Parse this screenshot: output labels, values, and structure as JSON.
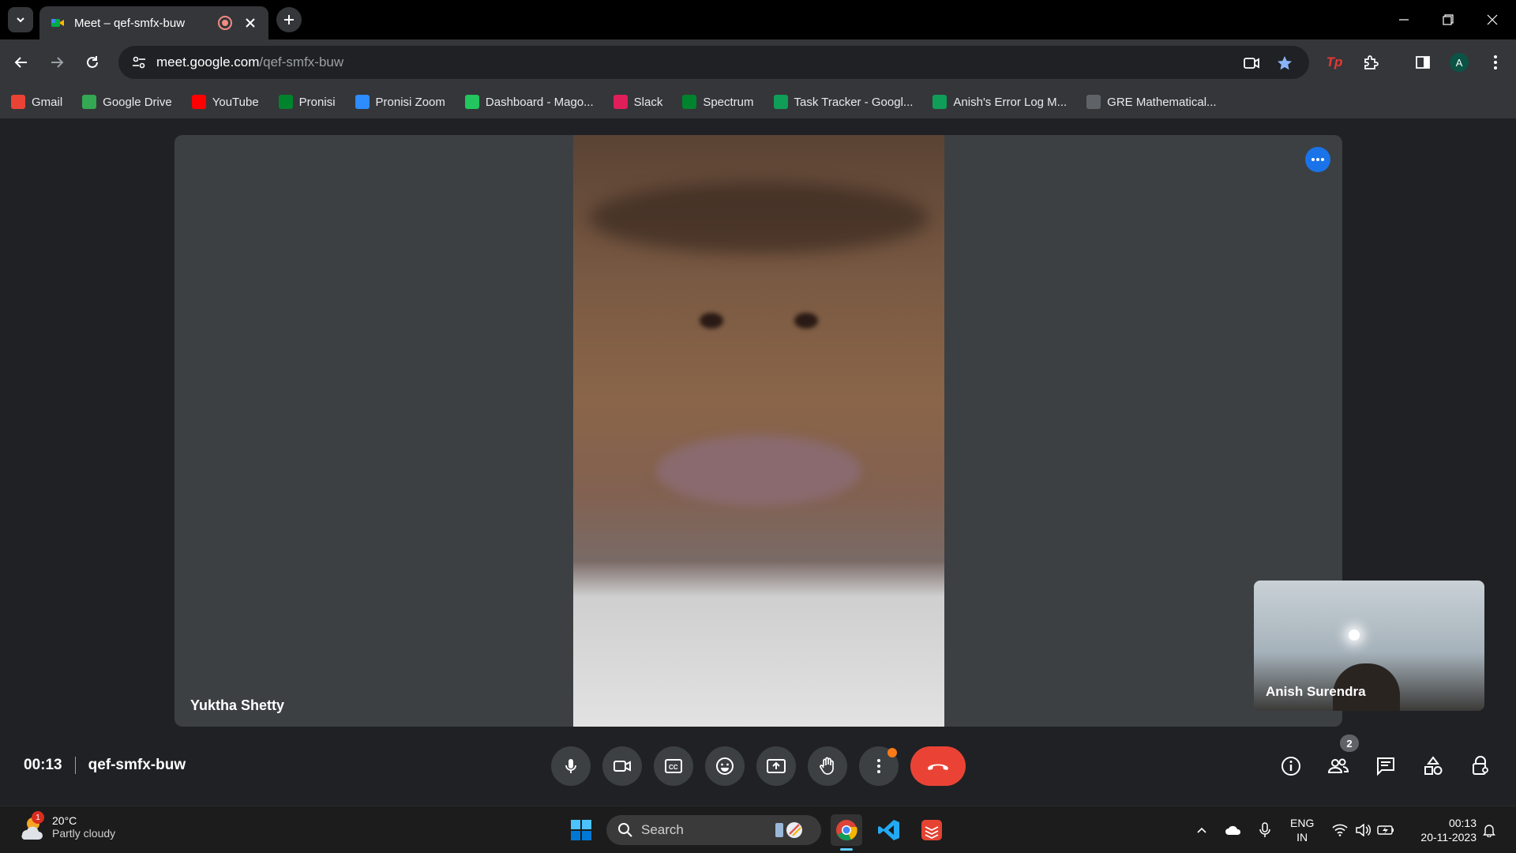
{
  "browser": {
    "tab_title": "Meet – qef-smfx-buw",
    "url_host": "meet.google.com",
    "url_path": "/qef-smfx-buw",
    "profile_initial": "A"
  },
  "bookmarks": [
    {
      "label": "Gmail",
      "icon": "gmail-icon",
      "color": "#ea4335"
    },
    {
      "label": "Google Drive",
      "icon": "drive-icon",
      "color": "#34a853"
    },
    {
      "label": "YouTube",
      "icon": "youtube-icon",
      "color": "#ff0000"
    },
    {
      "label": "Pronisi",
      "icon": "meet-icon",
      "color": "#00832d"
    },
    {
      "label": "Pronisi Zoom",
      "icon": "zoom-icon",
      "color": "#2d8cff"
    },
    {
      "label": "Dashboard - Mago...",
      "icon": "dashboard-icon",
      "color": "#22c55e"
    },
    {
      "label": "Slack",
      "icon": "slack-icon",
      "color": "#e01e5a"
    },
    {
      "label": "Spectrum",
      "icon": "meet-icon",
      "color": "#00832d"
    },
    {
      "label": "Task Tracker - Googl...",
      "icon": "sheets-icon",
      "color": "#0f9d58"
    },
    {
      "label": "Anish's Error Log M...",
      "icon": "sheets-icon",
      "color": "#0f9d58"
    },
    {
      "label": "GRE Mathematical...",
      "icon": "loader-icon",
      "color": "#5f6368"
    }
  ],
  "meeting": {
    "time": "00:13",
    "code": "qef-smfx-buw",
    "main_participant": "Yuktha Shetty",
    "self_participant": "Anish Surendra",
    "people_count": "2"
  },
  "taskbar": {
    "temperature": "20°C",
    "weather": "Partly cloudy",
    "weather_badge": "1",
    "search_label": "Search",
    "lang_line1": "ENG",
    "lang_line2": "IN",
    "time": "00:13",
    "date": "20-11-2023"
  },
  "colors": {
    "end_call": "#ea4335",
    "accent_blue": "#1a73e8",
    "tile_bg": "#3c4043"
  }
}
